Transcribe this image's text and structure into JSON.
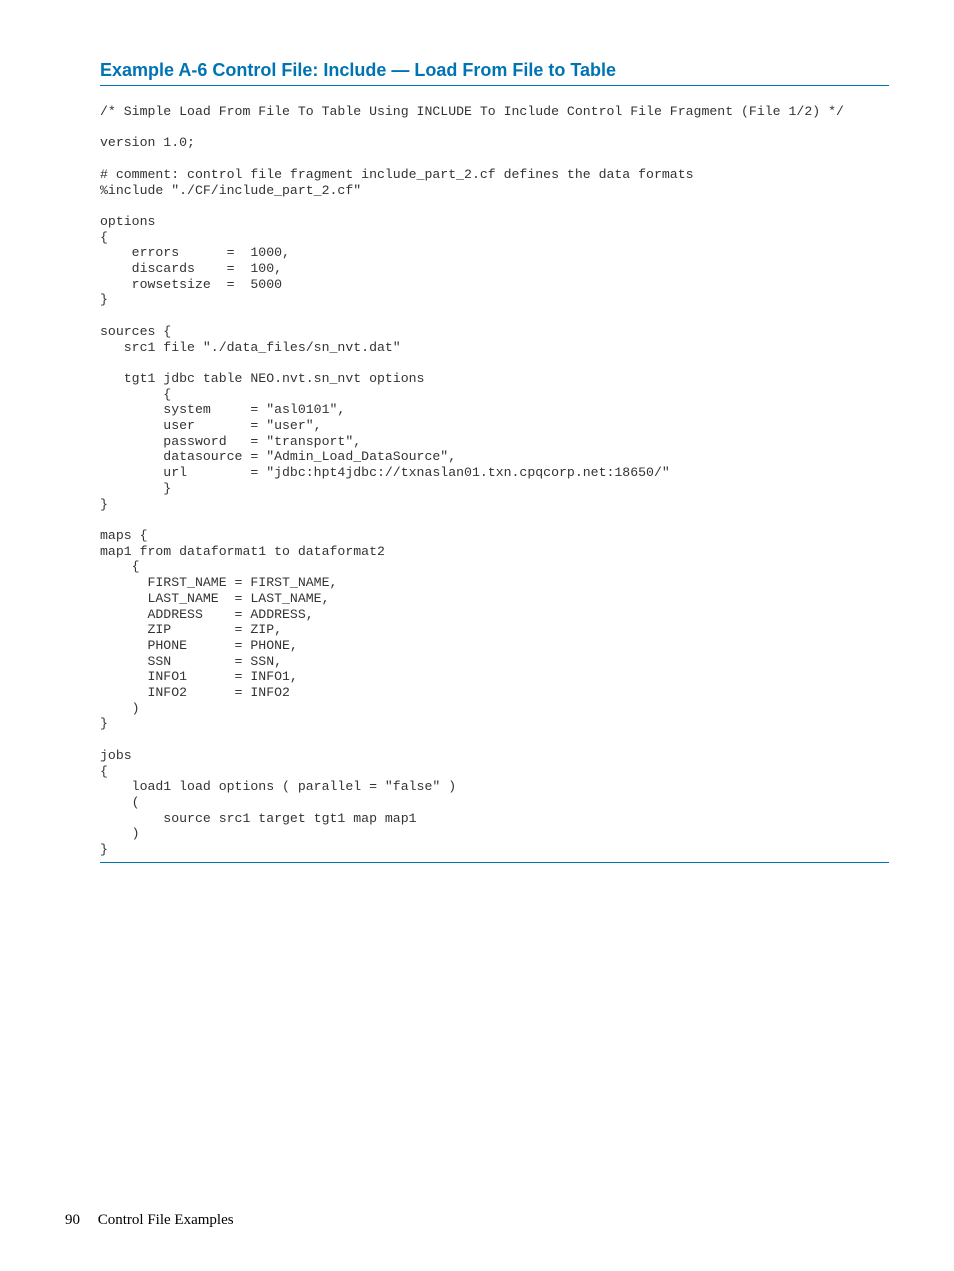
{
  "heading": "Example A-6 Control File: Include — Load From File to Table",
  "code": "/* Simple Load From File To Table Using INCLUDE To Include Control File Fragment (File 1/2) */\n\nversion 1.0;\n\n# comment: control file fragment include_part_2.cf defines the data formats\n%include \"./CF/include_part_2.cf\"\n\noptions\n{\n    errors      =  1000,\n    discards    =  100,\n    rowsetsize  =  5000\n}\n\nsources {\n   src1 file \"./data_files/sn_nvt.dat\"\n\n   tgt1 jdbc table NEO.nvt.sn_nvt options\n        {\n        system     = \"asl0101\",\n        user       = \"user\",\n        password   = \"transport\",\n        datasource = \"Admin_Load_DataSource\",\n        url        = \"jdbc:hpt4jdbc://txnaslan01.txn.cpqcorp.net:18650/\"\n        }\n}\n\nmaps {\nmap1 from dataformat1 to dataformat2\n    {\n      FIRST_NAME = FIRST_NAME,\n      LAST_NAME  = LAST_NAME,\n      ADDRESS    = ADDRESS,\n      ZIP        = ZIP,\n      PHONE      = PHONE,\n      SSN        = SSN,\n      INFO1      = INFO1,\n      INFO2      = INFO2\n    )\n}\n\njobs\n{\n    load1 load options ( parallel = \"false\" )\n    (\n        source src1 target tgt1 map map1\n    )\n}",
  "footer": {
    "page_number": "90",
    "section": "Control File Examples"
  }
}
